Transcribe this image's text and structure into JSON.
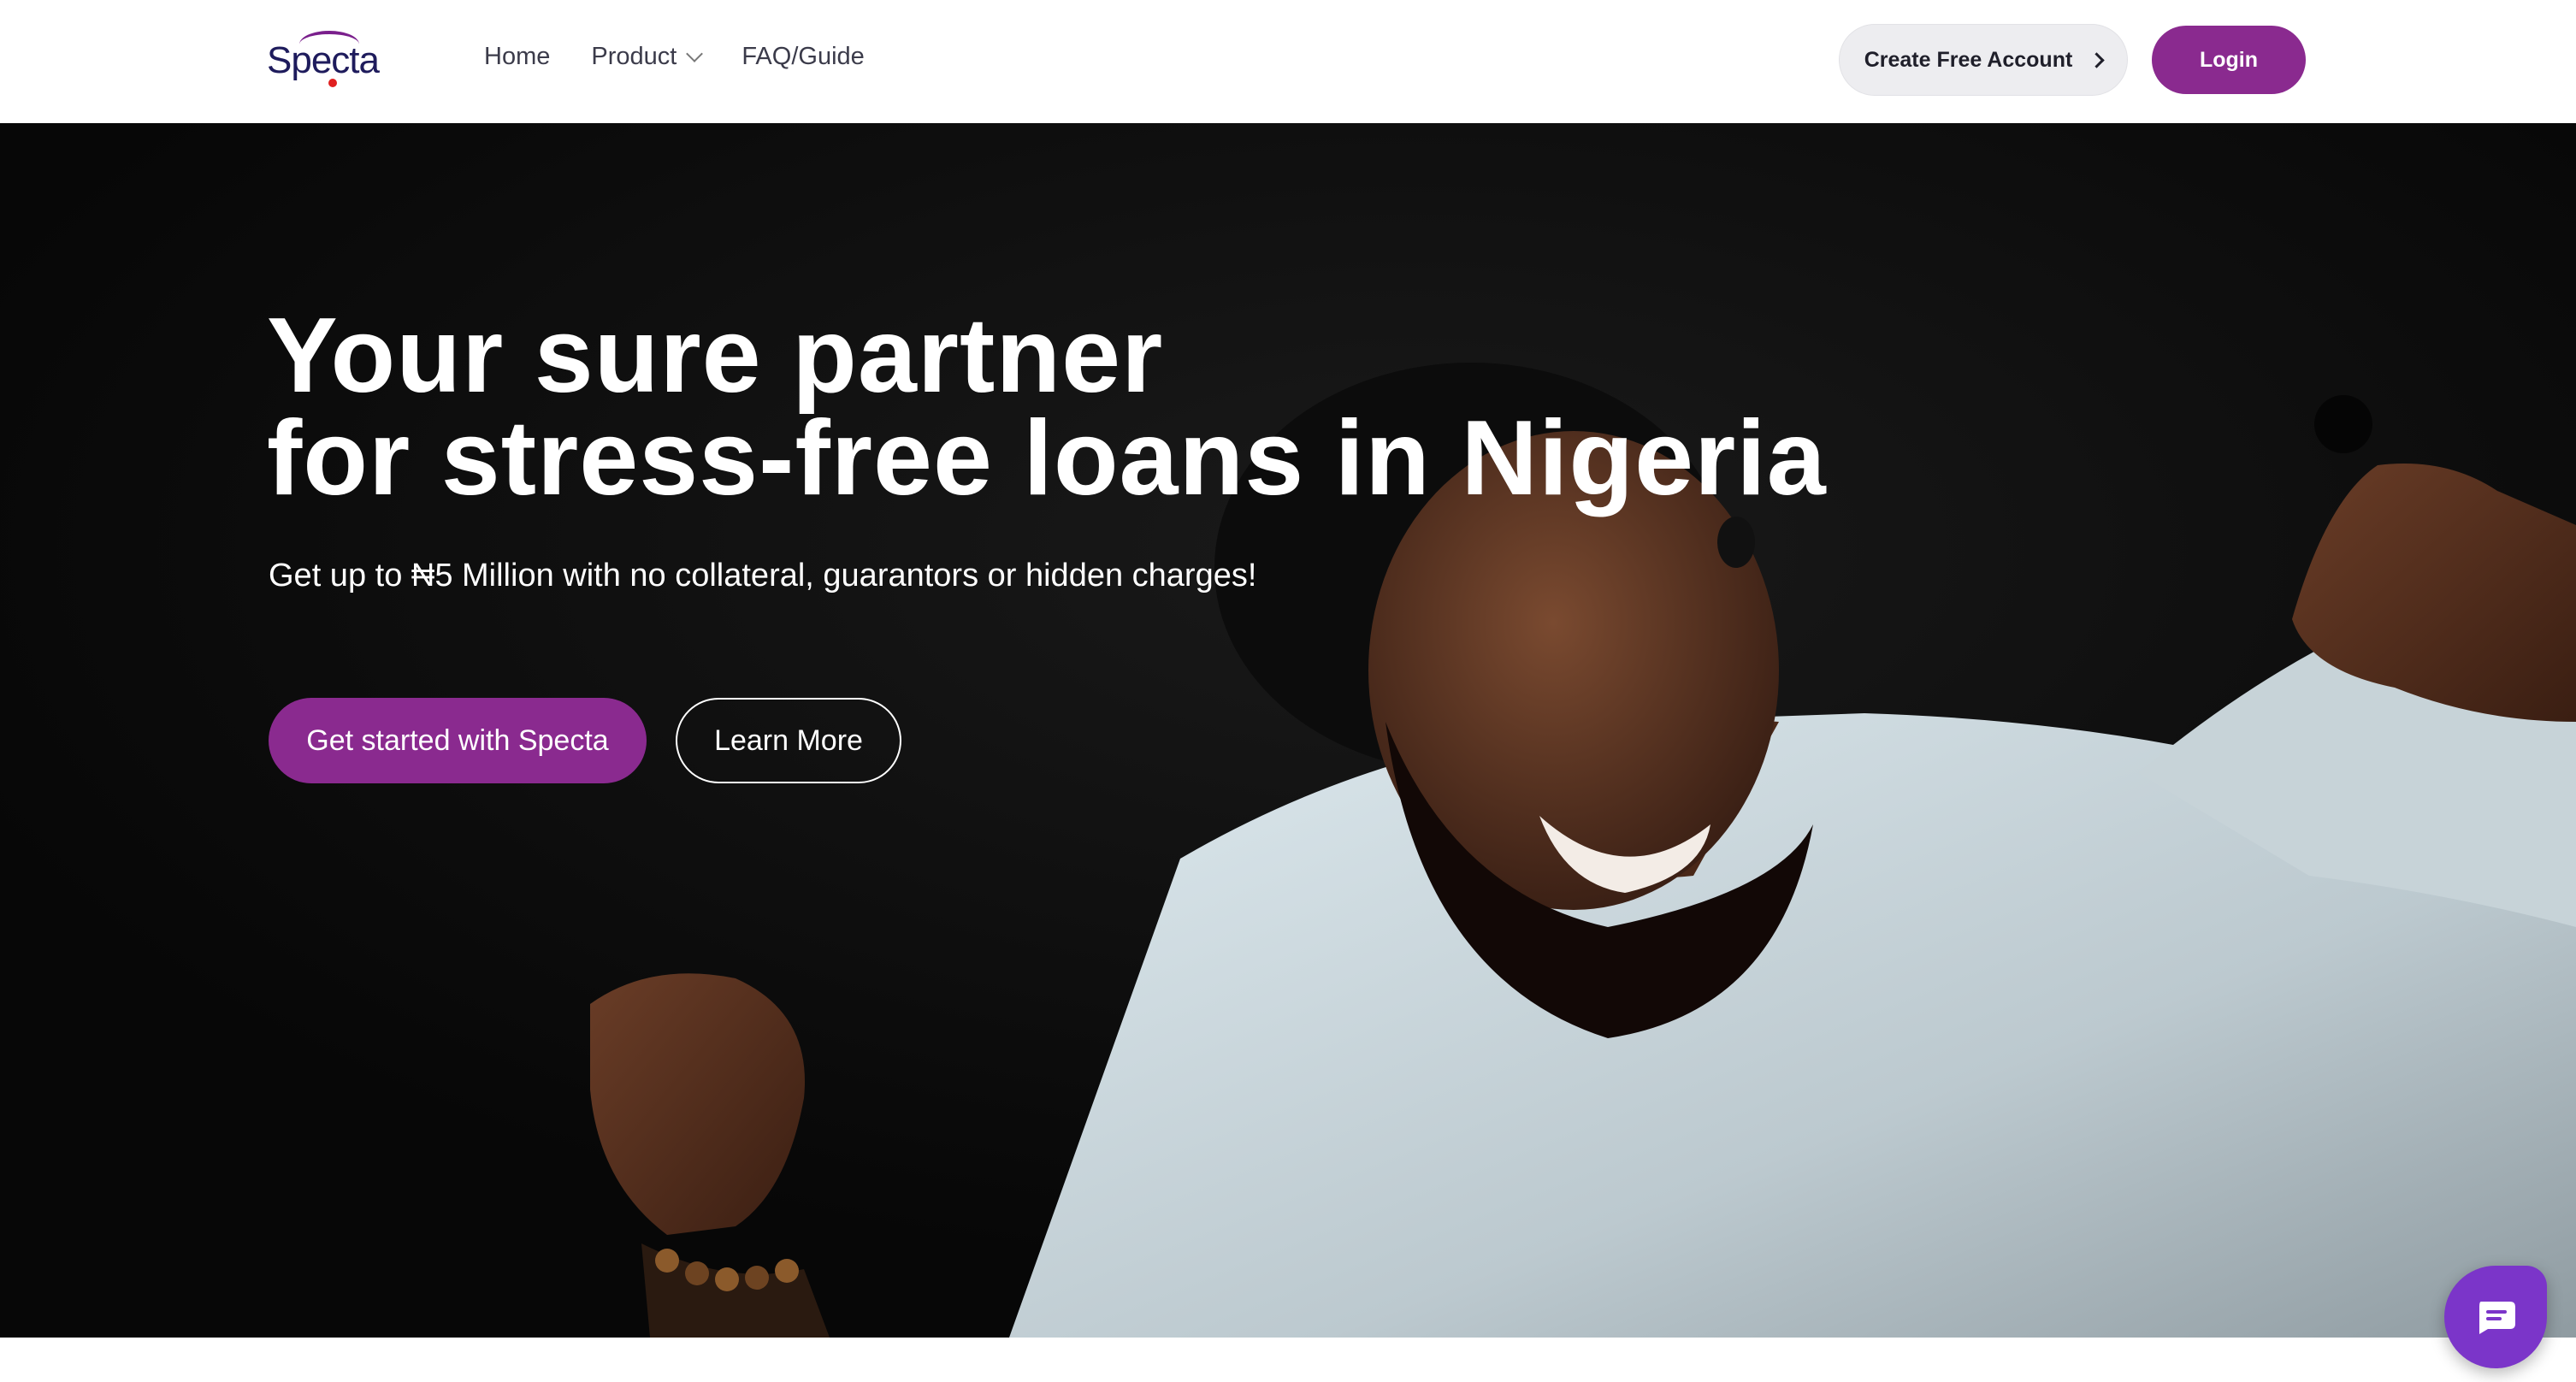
{
  "brand": {
    "name": "Specta",
    "colors": {
      "primary": "#8a2a8f",
      "navy": "#1e1b5c",
      "chat": "#7b35c9"
    }
  },
  "nav": {
    "links": [
      {
        "label": "Home"
      },
      {
        "label": "Product",
        "icon": "chevron-down-icon"
      },
      {
        "label": "FAQ/Guide"
      }
    ],
    "create_account_label": "Create Free Account",
    "login_label": "Login"
  },
  "hero": {
    "title_line1": "Your sure partner",
    "title_line2": "for stress-free loans in Nigeria",
    "subtitle": "Get up to ₦5 Million with no collateral, guarantors or hidden charges!",
    "primary_cta": "Get started with Specta",
    "secondary_cta": "Learn More"
  },
  "chat": {
    "icon": "chat-icon"
  }
}
